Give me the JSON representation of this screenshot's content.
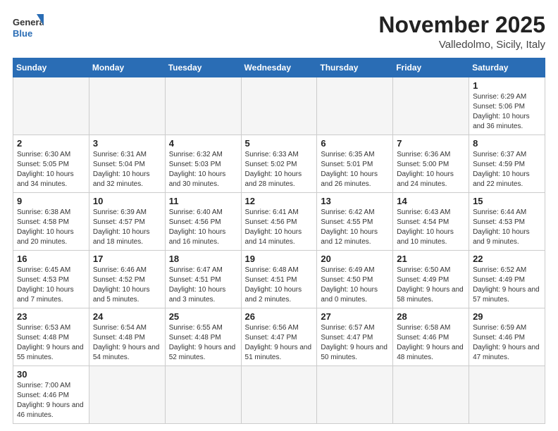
{
  "logo": {
    "line1": "General",
    "line2": "Blue"
  },
  "title": "November 2025",
  "location": "Valledolmo, Sicily, Italy",
  "weekdays": [
    "Sunday",
    "Monday",
    "Tuesday",
    "Wednesday",
    "Thursday",
    "Friday",
    "Saturday"
  ],
  "weeks": [
    [
      {
        "day": "",
        "info": ""
      },
      {
        "day": "",
        "info": ""
      },
      {
        "day": "",
        "info": ""
      },
      {
        "day": "",
        "info": ""
      },
      {
        "day": "",
        "info": ""
      },
      {
        "day": "",
        "info": ""
      },
      {
        "day": "1",
        "info": "Sunrise: 6:29 AM\nSunset: 5:06 PM\nDaylight: 10 hours and 36 minutes."
      }
    ],
    [
      {
        "day": "2",
        "info": "Sunrise: 6:30 AM\nSunset: 5:05 PM\nDaylight: 10 hours and 34 minutes."
      },
      {
        "day": "3",
        "info": "Sunrise: 6:31 AM\nSunset: 5:04 PM\nDaylight: 10 hours and 32 minutes."
      },
      {
        "day": "4",
        "info": "Sunrise: 6:32 AM\nSunset: 5:03 PM\nDaylight: 10 hours and 30 minutes."
      },
      {
        "day": "5",
        "info": "Sunrise: 6:33 AM\nSunset: 5:02 PM\nDaylight: 10 hours and 28 minutes."
      },
      {
        "day": "6",
        "info": "Sunrise: 6:35 AM\nSunset: 5:01 PM\nDaylight: 10 hours and 26 minutes."
      },
      {
        "day": "7",
        "info": "Sunrise: 6:36 AM\nSunset: 5:00 PM\nDaylight: 10 hours and 24 minutes."
      },
      {
        "day": "8",
        "info": "Sunrise: 6:37 AM\nSunset: 4:59 PM\nDaylight: 10 hours and 22 minutes."
      }
    ],
    [
      {
        "day": "9",
        "info": "Sunrise: 6:38 AM\nSunset: 4:58 PM\nDaylight: 10 hours and 20 minutes."
      },
      {
        "day": "10",
        "info": "Sunrise: 6:39 AM\nSunset: 4:57 PM\nDaylight: 10 hours and 18 minutes."
      },
      {
        "day": "11",
        "info": "Sunrise: 6:40 AM\nSunset: 4:56 PM\nDaylight: 10 hours and 16 minutes."
      },
      {
        "day": "12",
        "info": "Sunrise: 6:41 AM\nSunset: 4:56 PM\nDaylight: 10 hours and 14 minutes."
      },
      {
        "day": "13",
        "info": "Sunrise: 6:42 AM\nSunset: 4:55 PM\nDaylight: 10 hours and 12 minutes."
      },
      {
        "day": "14",
        "info": "Sunrise: 6:43 AM\nSunset: 4:54 PM\nDaylight: 10 hours and 10 minutes."
      },
      {
        "day": "15",
        "info": "Sunrise: 6:44 AM\nSunset: 4:53 PM\nDaylight: 10 hours and 9 minutes."
      }
    ],
    [
      {
        "day": "16",
        "info": "Sunrise: 6:45 AM\nSunset: 4:53 PM\nDaylight: 10 hours and 7 minutes."
      },
      {
        "day": "17",
        "info": "Sunrise: 6:46 AM\nSunset: 4:52 PM\nDaylight: 10 hours and 5 minutes."
      },
      {
        "day": "18",
        "info": "Sunrise: 6:47 AM\nSunset: 4:51 PM\nDaylight: 10 hours and 3 minutes."
      },
      {
        "day": "19",
        "info": "Sunrise: 6:48 AM\nSunset: 4:51 PM\nDaylight: 10 hours and 2 minutes."
      },
      {
        "day": "20",
        "info": "Sunrise: 6:49 AM\nSunset: 4:50 PM\nDaylight: 10 hours and 0 minutes."
      },
      {
        "day": "21",
        "info": "Sunrise: 6:50 AM\nSunset: 4:49 PM\nDaylight: 9 hours and 58 minutes."
      },
      {
        "day": "22",
        "info": "Sunrise: 6:52 AM\nSunset: 4:49 PM\nDaylight: 9 hours and 57 minutes."
      }
    ],
    [
      {
        "day": "23",
        "info": "Sunrise: 6:53 AM\nSunset: 4:48 PM\nDaylight: 9 hours and 55 minutes."
      },
      {
        "day": "24",
        "info": "Sunrise: 6:54 AM\nSunset: 4:48 PM\nDaylight: 9 hours and 54 minutes."
      },
      {
        "day": "25",
        "info": "Sunrise: 6:55 AM\nSunset: 4:48 PM\nDaylight: 9 hours and 52 minutes."
      },
      {
        "day": "26",
        "info": "Sunrise: 6:56 AM\nSunset: 4:47 PM\nDaylight: 9 hours and 51 minutes."
      },
      {
        "day": "27",
        "info": "Sunrise: 6:57 AM\nSunset: 4:47 PM\nDaylight: 9 hours and 50 minutes."
      },
      {
        "day": "28",
        "info": "Sunrise: 6:58 AM\nSunset: 4:46 PM\nDaylight: 9 hours and 48 minutes."
      },
      {
        "day": "29",
        "info": "Sunrise: 6:59 AM\nSunset: 4:46 PM\nDaylight: 9 hours and 47 minutes."
      }
    ],
    [
      {
        "day": "30",
        "info": "Sunrise: 7:00 AM\nSunset: 4:46 PM\nDaylight: 9 hours and 46 minutes."
      },
      {
        "day": "",
        "info": ""
      },
      {
        "day": "",
        "info": ""
      },
      {
        "day": "",
        "info": ""
      },
      {
        "day": "",
        "info": ""
      },
      {
        "day": "",
        "info": ""
      },
      {
        "day": "",
        "info": ""
      }
    ]
  ],
  "colors": {
    "header_bg": "#2a6db5",
    "header_text": "#ffffff",
    "border": "#bbbbbb",
    "empty_bg": "#f5f5f5"
  }
}
